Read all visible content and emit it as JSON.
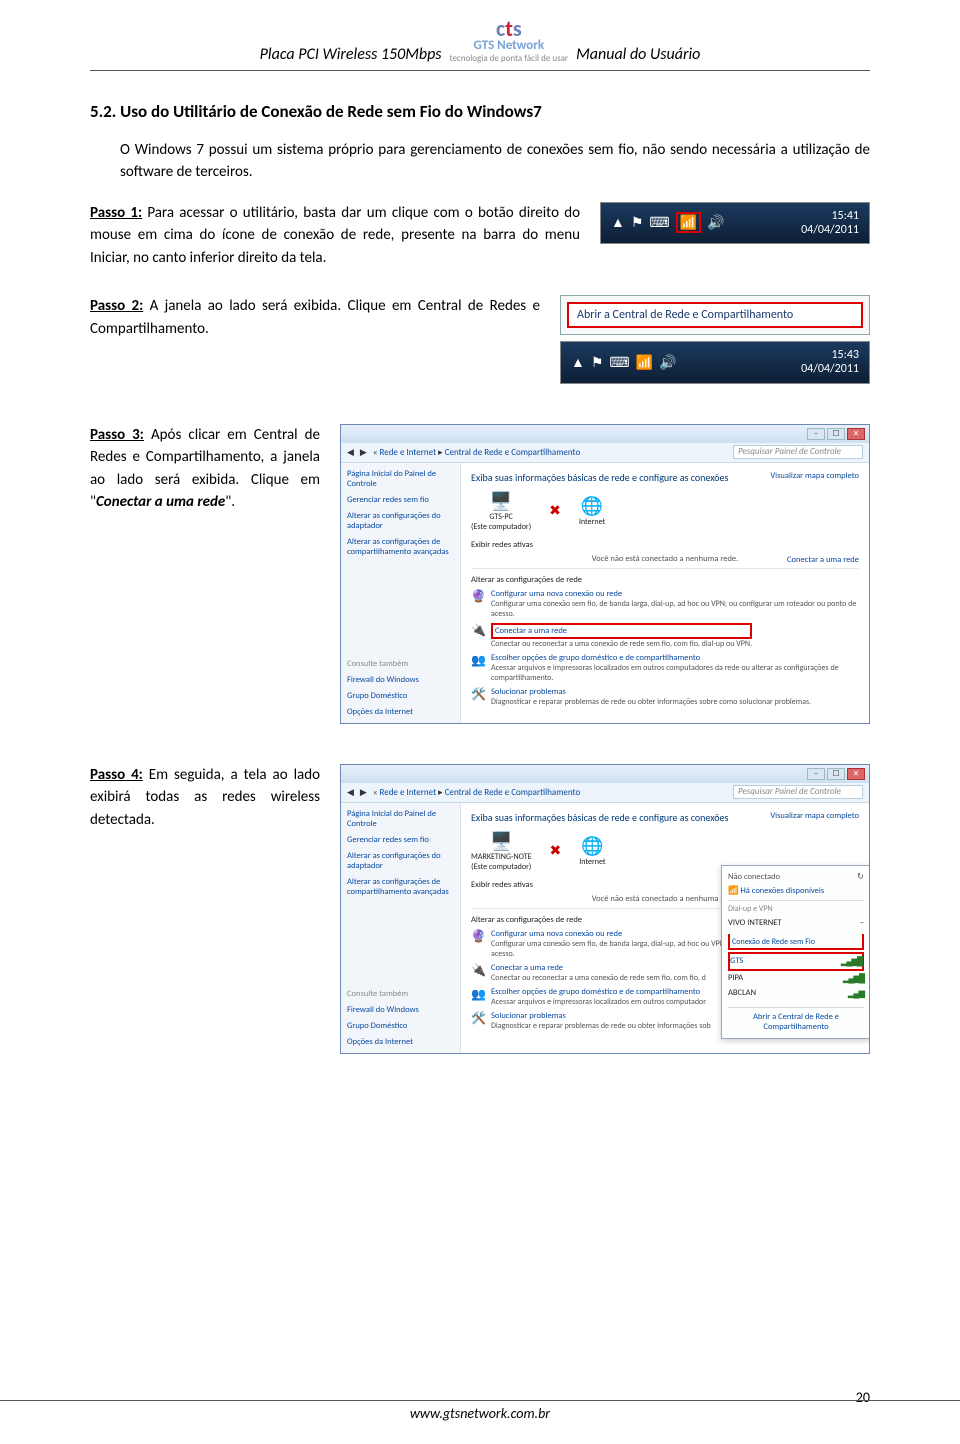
{
  "header": {
    "left": "Placa PCI Wireless 150Mbps",
    "right": "Manual do Usuário",
    "logo_brand": "GTS Network",
    "logo_tag": "tecnologia de ponta fácil de usar"
  },
  "section_title": "5.2. Uso do Utilitário de Conexão de Rede sem Fio do Windows7",
  "intro": "O Windows 7 possui um sistema próprio para gerenciamento de conexões sem fio, não sendo necessária a utilização de software de terceiros.",
  "step1": {
    "label": "Passo 1:",
    "text": " Para acessar o utilitário, basta dar um clique com o botão direito do mouse em cima do ícone de conexão de rede, presente na barra do menu Iniciar, no canto inferior direito da tela."
  },
  "step2": {
    "label": "Passo 2:",
    "text": " A janela ao lado será exibida. Clique em Central de Redes e Compartilhamento."
  },
  "step3": {
    "label": "Passo 3:",
    "text_a": " Após clicar em Central de Redes e Compartilhamento, a janela ao lado será exibida. Clique em \"",
    "em": "Conectar a uma rede",
    "text_b": "\"."
  },
  "step4": {
    "label": "Passo 4:",
    "text": " Em seguida, a tela ao lado exibirá todas as redes wireless detectada."
  },
  "taskbar1": {
    "time": "15:41",
    "date": "04/04/2011"
  },
  "taskbar2": {
    "time": "15:43",
    "date": "04/04/2011"
  },
  "ctx_item": "Abrir a Central de Rede e Compartilhamento",
  "win": {
    "crumb_a": "Rede e Internet",
    "crumb_b": "Central de Rede e Compartilhamento",
    "search_ph": "Pesquisar Painel de Controle",
    "sidebar": {
      "home": "Página Inicial do Painel de Controle",
      "s1": "Gerenciar redes sem fio",
      "s2": "Alterar as configurações do adaptador",
      "s3": "Alterar as configurações de compartilhamento avançadas",
      "also": "Consulte também",
      "a1": "Firewall do Windows",
      "a2": "Grupo Doméstico",
      "a3": "Opções da Internet"
    },
    "main": {
      "title": "Exiba suas informações básicas de rede e configure as conexões",
      "map": "Visualizar mapa completo",
      "pc1": "GTS-PC",
      "pc1b": "(Este computador)",
      "pc2": "MARKETING-NOTE",
      "inet": "Internet",
      "active_hdr": "Exibir redes ativas",
      "active_msg": "Você não está conectado a nenhuma rede.",
      "connect": "Conectar a uma rede",
      "chg_hdr": "Alterar as configurações de rede",
      "o1t": "Configurar uma nova conexão ou rede",
      "o1d": "Configurar uma conexão sem fio, de banda larga, dial-up, ad hoc ou VPN; ou configurar um roteador ou ponto de acesso.",
      "o2t": "Conectar a uma rede",
      "o2d_a": "Conectar ou reconectar a uma conexão de rede sem fio, com fio, dial-up ou VPN.",
      "o2d_b": "Conectar ou reconectar a uma conexão de rede sem fio, com fio, d",
      "o3t": "Escolher opções de grupo doméstico e de compartilhamento",
      "o3d": "Acessar arquivos e impressoras localizados em outros computadores da rede ou alterar as configurações de compartilhamento.",
      "o3d_b": "Acessar arquivos e impressoras localizados em outros computador",
      "o4t": "Solucionar problemas",
      "o4d": "Diagnosticar e reparar problemas de rede ou obter informações sobre como solucionar problemas.",
      "o4d_b": "Diagnosticar e reparar problemas de rede ou obter informações sob"
    }
  },
  "wifi": {
    "status": "Não conectado",
    "avail": "Há conexões disponíveis",
    "sec1": "Dial-up e VPN",
    "vpn": "VIVO INTERNET",
    "sec2": "Conexão de Rede sem Fio",
    "n1": "GTS",
    "n2": "PIPA",
    "n3": "ABCLAN",
    "foot": "Abrir a Central de Rede e Compartilhamento"
  },
  "footer_url": "www.gtsnetwork.com.br",
  "page_num": "20"
}
